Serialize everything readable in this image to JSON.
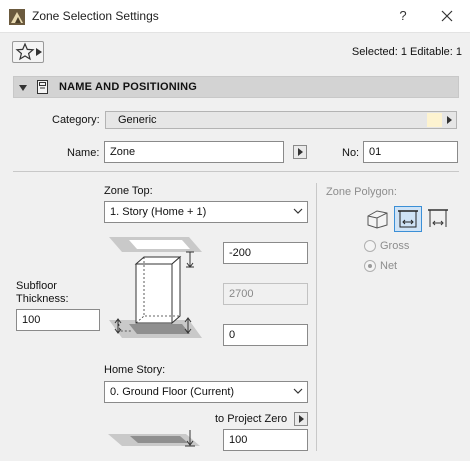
{
  "window": {
    "title": "Zone Selection Settings",
    "help_label": "?"
  },
  "toolbar": {
    "selection_info": "Selected: 1 Editable: 1"
  },
  "section": {
    "title": "NAME AND POSITIONING"
  },
  "category": {
    "label": "Category:",
    "value": "Generic",
    "swatch_color": "#fdf3d0"
  },
  "name": {
    "label": "Name:",
    "value": "Zone"
  },
  "number": {
    "label": "No:",
    "value": "01"
  },
  "zone_top": {
    "label": "Zone Top:",
    "value": "1. Story (Home + 1)"
  },
  "offsets": {
    "top_offset": "-200",
    "height": "2700",
    "bottom_offset": "0"
  },
  "subfloor": {
    "label_line1": "Subfloor",
    "label_line2": "Thickness:",
    "value": "100"
  },
  "home_story": {
    "label": "Home Story:",
    "value": "0. Ground Floor (Current)"
  },
  "project_zero": {
    "label": "to Project Zero",
    "value": "100"
  },
  "zone_polygon": {
    "label": "Zone Polygon:",
    "options": [
      {
        "label": "Gross",
        "selected": false
      },
      {
        "label": "Net",
        "selected": true
      }
    ]
  }
}
